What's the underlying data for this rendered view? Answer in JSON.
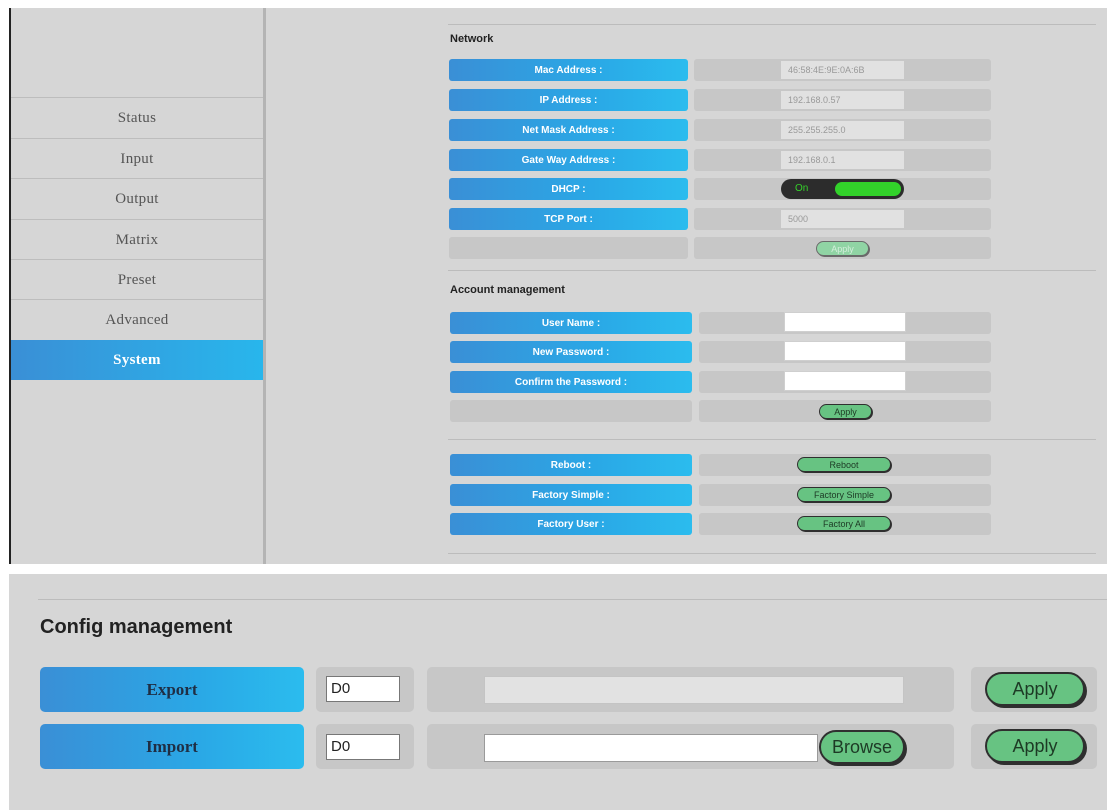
{
  "sidebar": {
    "items": [
      {
        "label": "Status"
      },
      {
        "label": "Input"
      },
      {
        "label": "Output"
      },
      {
        "label": "Matrix"
      },
      {
        "label": "Preset"
      },
      {
        "label": "Advanced"
      },
      {
        "label": "System",
        "active": true
      }
    ]
  },
  "network": {
    "title": "Network",
    "mac_label": "Mac Address :",
    "mac_value": "46:58:4E:9E:0A:6B",
    "ip_label": "IP Address :",
    "ip_value": "192.168.0.57",
    "mask_label": "Net Mask Address :",
    "mask_value": "255.255.255.0",
    "gateway_label": "Gate Way Address :",
    "gateway_value": "192.168.0.1",
    "dhcp_label": "DHCP :",
    "dhcp_state": "On",
    "tcp_label": "TCP Port :",
    "tcp_value": "5000",
    "apply_label": "Apply"
  },
  "account": {
    "title": "Account management",
    "username_label": "User Name :",
    "new_password_label": "New Password :",
    "confirm_password_label": "Confirm the Password :",
    "username_value": "",
    "new_password_value": "",
    "confirm_password_value": "",
    "apply_label": "Apply"
  },
  "maintenance": {
    "reboot_label": "Reboot :",
    "reboot_button": "Reboot",
    "factory_simple_label": "Factory Simple :",
    "factory_simple_button": "Factory Simple",
    "factory_user_label": "Factory User :",
    "factory_user_button": "Factory All"
  },
  "config": {
    "title": "Config management",
    "export_label": "Export",
    "export_select": "D0",
    "export_path": "",
    "export_apply": "Apply",
    "import_label": "Import",
    "import_select": "D0",
    "import_path": "",
    "browse_label": "Browse",
    "import_apply": "Apply"
  },
  "colors": {
    "accent_blue": "#2aa8e6",
    "button_green": "#67c382",
    "toggle_on": "#32d22a",
    "panel_bg": "#d6d6d6"
  }
}
